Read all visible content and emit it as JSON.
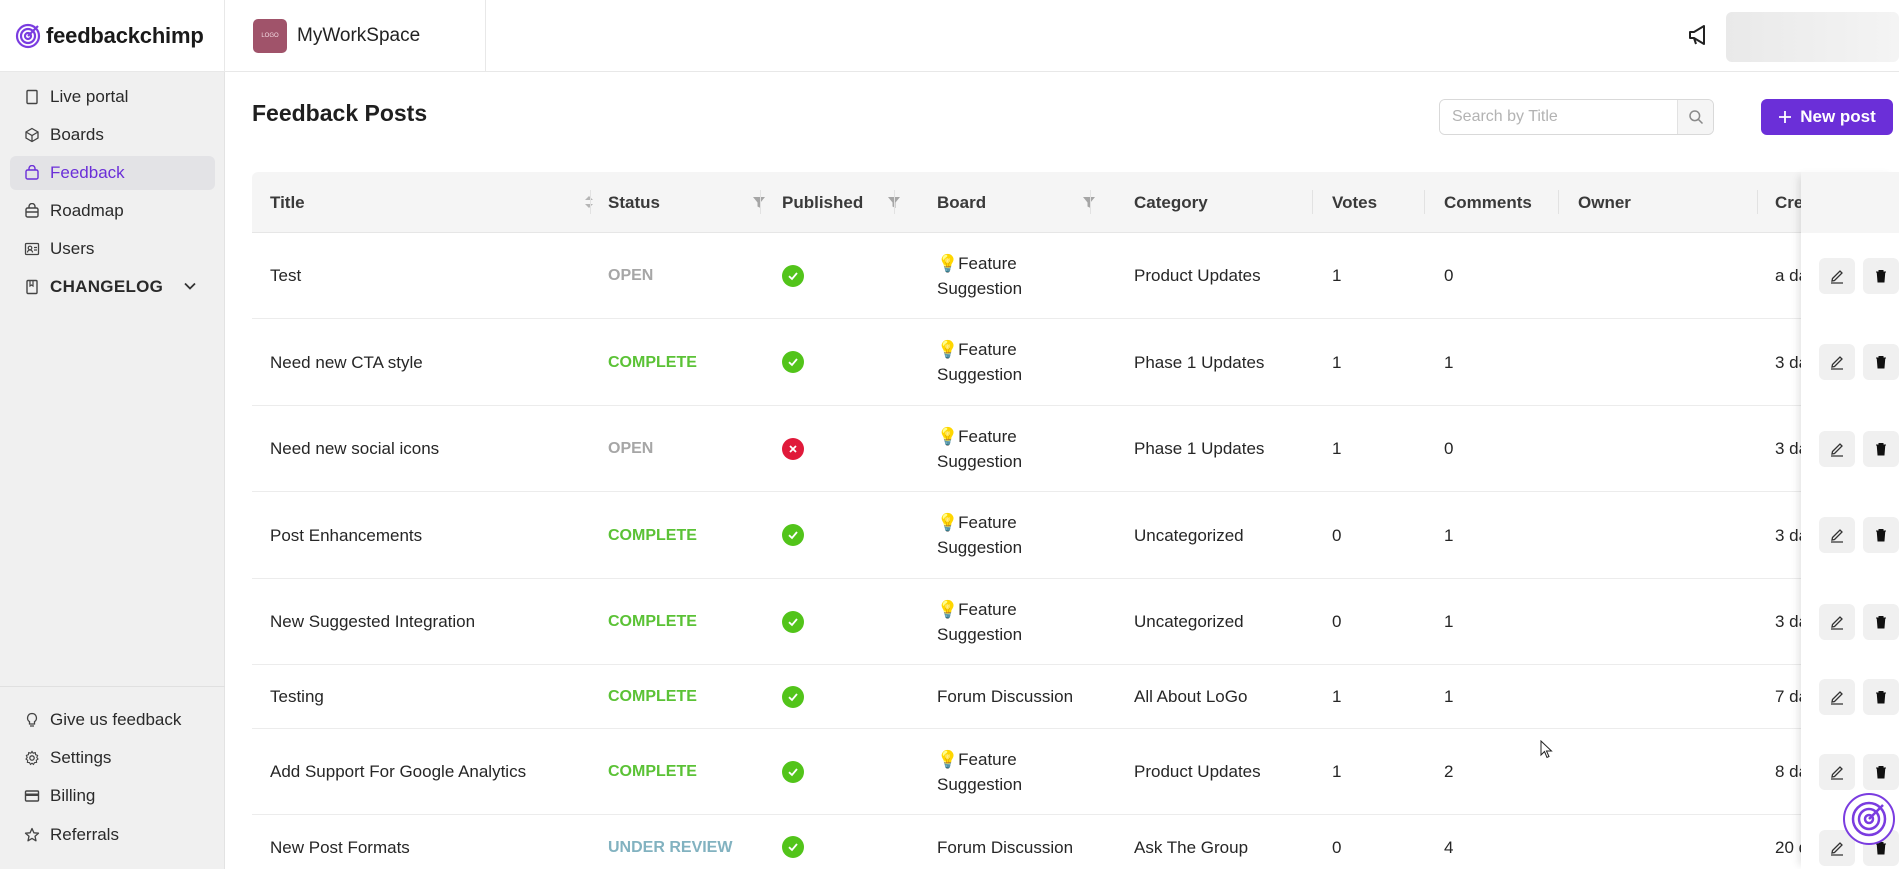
{
  "brand": {
    "name": "feedbackchimp"
  },
  "workspace": {
    "logo_text": "LOGO",
    "name": "MyWorkSpace"
  },
  "sidebar": {
    "items": [
      {
        "label": "Live portal",
        "icon": "portal-icon"
      },
      {
        "label": "Boards",
        "icon": "boards-icon"
      },
      {
        "label": "Feedback",
        "icon": "feedback-icon",
        "active": true
      },
      {
        "label": "Roadmap",
        "icon": "roadmap-icon"
      },
      {
        "label": "Users",
        "icon": "users-icon"
      },
      {
        "label": "CHANGELOG",
        "icon": "changelog-icon"
      }
    ],
    "bottom_items": [
      {
        "label": "Give us feedback",
        "icon": "lightbulb-icon"
      },
      {
        "label": "Settings",
        "icon": "gear-icon"
      },
      {
        "label": "Billing",
        "icon": "billing-icon"
      },
      {
        "label": "Referrals",
        "icon": "star-icon"
      }
    ]
  },
  "main": {
    "title": "Feedback Posts",
    "search_placeholder": "Search by Title",
    "new_post_label": "New post"
  },
  "table": {
    "columns": [
      "Title",
      "Status",
      "Published",
      "Board",
      "Category",
      "Votes",
      "Comments",
      "Owner",
      "Cre"
    ],
    "rows": [
      {
        "title": "Test",
        "status": "OPEN",
        "published": true,
        "board": "💡Feature\nSuggestion",
        "category": "Product Updates",
        "votes": "1",
        "comments": "0",
        "owner": "",
        "created": "a da"
      },
      {
        "title": "Need new CTA style",
        "status": "COMPLETE",
        "published": true,
        "board": "💡Feature\nSuggestion",
        "category": "Phase 1 Updates",
        "votes": "1",
        "comments": "1",
        "owner": "",
        "created": "3 da"
      },
      {
        "title": "Need new social icons",
        "status": "OPEN",
        "published": false,
        "board": "💡Feature\nSuggestion",
        "category": "Phase 1 Updates",
        "votes": "1",
        "comments": "0",
        "owner": "",
        "created": "3 da"
      },
      {
        "title": "Post Enhancements",
        "status": "COMPLETE",
        "published": true,
        "board": "💡Feature\nSuggestion",
        "category": "Uncategorized",
        "votes": "0",
        "comments": "1",
        "owner": "",
        "created": "3 da"
      },
      {
        "title": "New Suggested Integration",
        "status": "COMPLETE",
        "published": true,
        "board": "💡Feature\nSuggestion",
        "category": "Uncategorized",
        "votes": "0",
        "comments": "1",
        "owner": "",
        "created": "3 da"
      },
      {
        "title": "Testing",
        "status": "COMPLETE",
        "published": true,
        "board": "Forum Discussion",
        "category": "All About LoGo",
        "votes": "1",
        "comments": "1",
        "owner": "",
        "created": "7 da"
      },
      {
        "title": "Add Support For Google Analytics",
        "status": "COMPLETE",
        "published": true,
        "board": "💡Feature\nSuggestion",
        "category": "Product Updates",
        "votes": "1",
        "comments": "2",
        "owner": "",
        "created": "8 da"
      },
      {
        "title": "New Post Formats",
        "status": "UNDER REVIEW",
        "published": true,
        "board": "Forum Discussion",
        "category": "Ask The Group",
        "votes": "0",
        "comments": "4",
        "owner": "",
        "created": "20 d"
      }
    ]
  },
  "colors": {
    "accent": "#6b2fd8",
    "status_open": "#a6a6a6",
    "status_complete": "#5bc236",
    "status_under_review": "#82b2c0",
    "published_yes": "#52c41a",
    "published_no": "#e0193a"
  }
}
